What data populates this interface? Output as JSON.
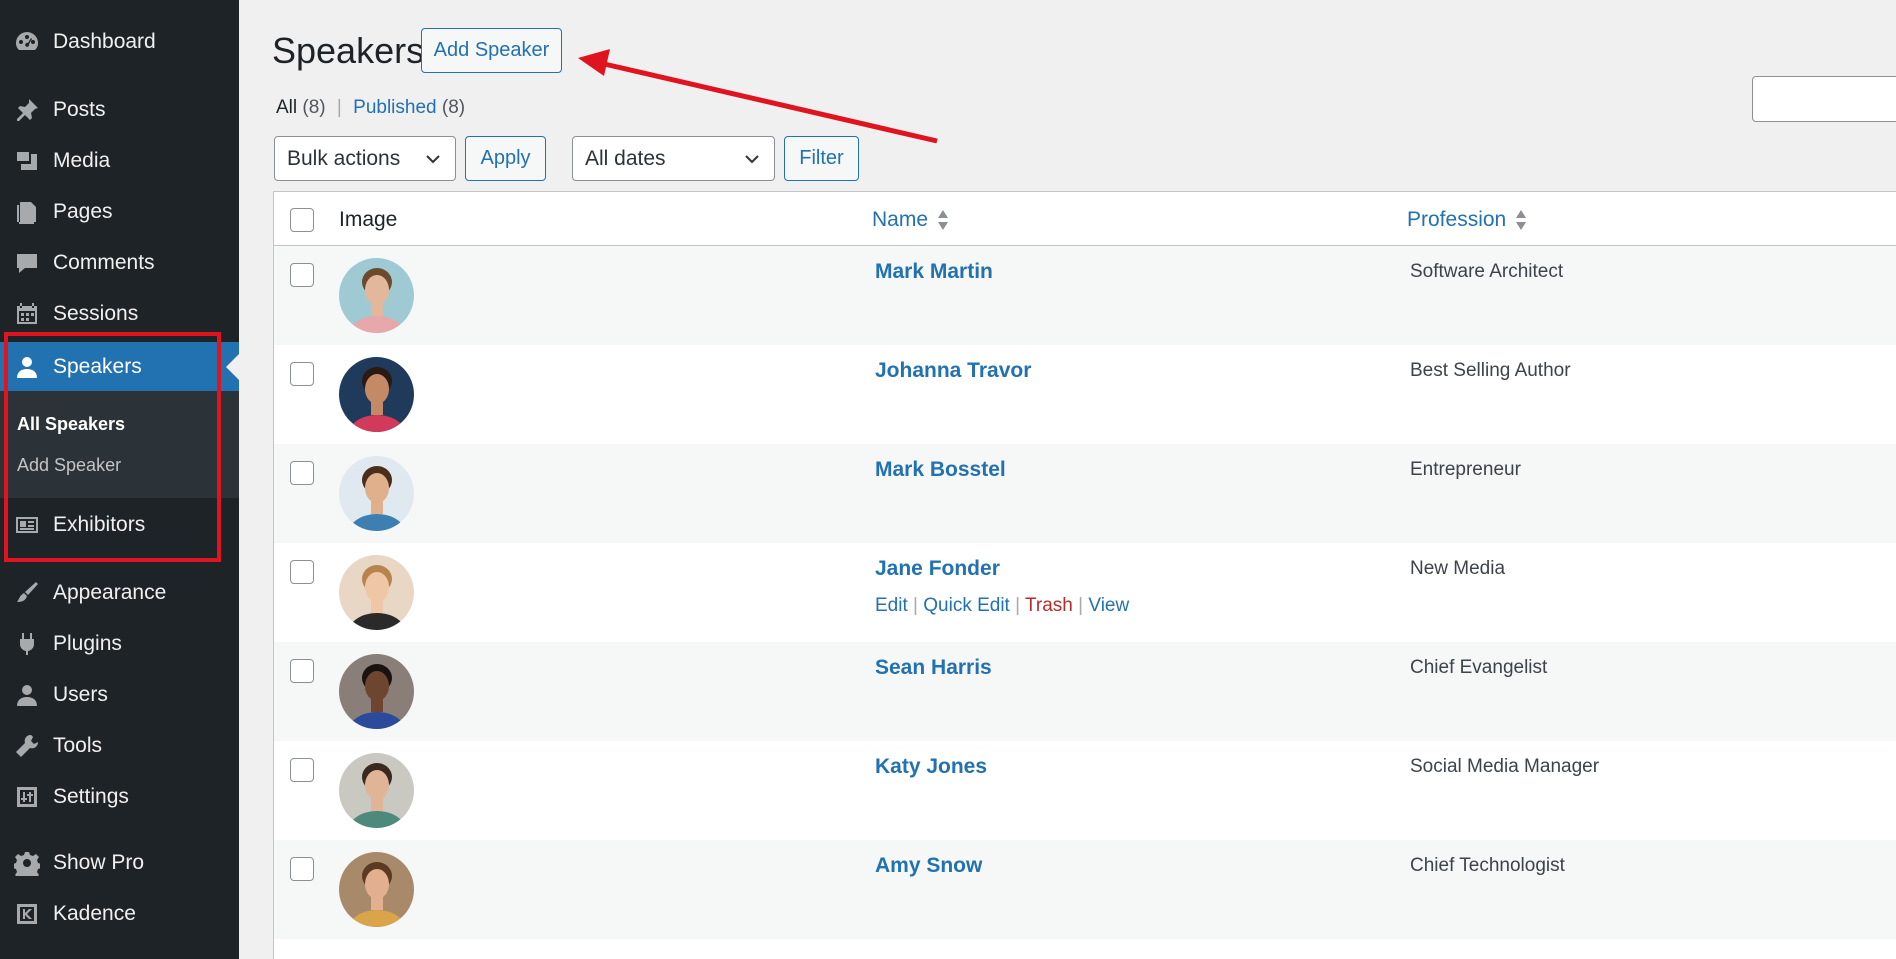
{
  "sidebar": {
    "items": [
      {
        "id": "dashboard",
        "label": "Dashboard",
        "icon": "dashboard-icon"
      },
      {
        "id": "posts",
        "label": "Posts",
        "icon": "pin-icon"
      },
      {
        "id": "media",
        "label": "Media",
        "icon": "media-icon"
      },
      {
        "id": "pages",
        "label": "Pages",
        "icon": "pages-icon"
      },
      {
        "id": "comments",
        "label": "Comments",
        "icon": "comment-icon"
      },
      {
        "id": "sessions",
        "label": "Sessions",
        "icon": "calendar-icon"
      },
      {
        "id": "speakers",
        "label": "Speakers",
        "icon": "user-icon"
      },
      {
        "id": "exhibitors",
        "label": "Exhibitors",
        "icon": "id-card-icon"
      },
      {
        "id": "appearance",
        "label": "Appearance",
        "icon": "brush-icon"
      },
      {
        "id": "plugins",
        "label": "Plugins",
        "icon": "plugin-icon"
      },
      {
        "id": "users",
        "label": "Users",
        "icon": "users-icon"
      },
      {
        "id": "tools",
        "label": "Tools",
        "icon": "wrench-icon"
      },
      {
        "id": "settings",
        "label": "Settings",
        "icon": "sliders-icon"
      },
      {
        "id": "showpro",
        "label": "Show Pro",
        "icon": "gear-icon"
      },
      {
        "id": "kadence",
        "label": "Kadence",
        "icon": "kadence-icon"
      }
    ],
    "submenu": {
      "all_speakers": "All Speakers",
      "add_speaker": "Add Speaker"
    }
  },
  "header": {
    "title": "Speakers",
    "add_button": "Add Speaker"
  },
  "views": {
    "all_label": "All",
    "all_count": "(8)",
    "separator": "|",
    "published_label": "Published",
    "published_count": "(8)"
  },
  "toolbar": {
    "bulk_actions": "Bulk actions",
    "apply": "Apply",
    "dates": "All dates",
    "filter": "Filter"
  },
  "table": {
    "columns": {
      "image": "Image",
      "name": "Name",
      "profession": "Profession"
    },
    "row_actions": {
      "edit": "Edit",
      "quick_edit": "Quick Edit",
      "trash": "Trash",
      "view": "View",
      "separator": "|"
    },
    "rows": [
      {
        "name": "Mark Martin",
        "profession": "Software Architect",
        "avatar_bg": "#9fcad3",
        "skin": "#e3b79b",
        "hair": "#6b4a2e",
        "shirt": "#e8a7a9"
      },
      {
        "name": "Johanna Travor",
        "profession": "Best Selling Author",
        "avatar_bg": "#1f3a5a",
        "skin": "#c48a66",
        "hair": "#2a1a12",
        "shirt": "#d23a5c"
      },
      {
        "name": "Mark Bosstel",
        "profession": "Entrepreneur",
        "avatar_bg": "#dfe9ef",
        "skin": "#e0b08c",
        "hair": "#4a2e1c",
        "shirt": "#3d7fb1"
      },
      {
        "name": "Jane Fonder",
        "profession": "New Media",
        "avatar_bg": "#e9d7c5",
        "skin": "#efc6a6",
        "hair": "#b8844e",
        "shirt": "#2a2a2a"
      },
      {
        "name": "Sean Harris",
        "profession": "Chief Evangelist",
        "avatar_bg": "#8a7f78",
        "skin": "#6e4630",
        "hair": "#1a1210",
        "shirt": "#2b4a9c"
      },
      {
        "name": "Katy Jones",
        "profession": "Social Media Manager",
        "avatar_bg": "#c9c9c1",
        "skin": "#e0b496",
        "hair": "#3a2a1e",
        "shirt": "#4d8a7c"
      },
      {
        "name": "Amy Snow",
        "profession": "Chief Technologist",
        "avatar_bg": "#a88a6a",
        "skin": "#e2b08e",
        "hair": "#5a3a22",
        "shirt": "#d9a44a"
      }
    ]
  }
}
